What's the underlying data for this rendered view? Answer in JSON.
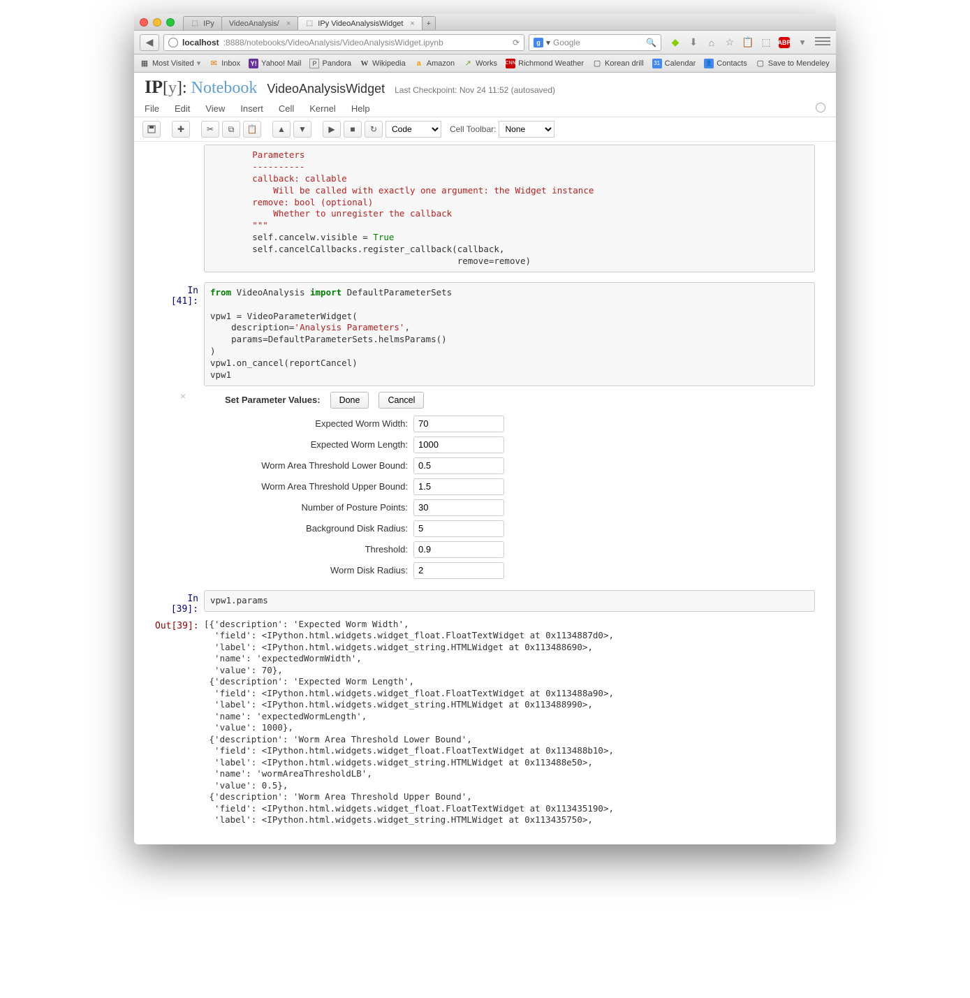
{
  "browser": {
    "tabs": [
      {
        "icon": "ipy",
        "label": "IPy",
        "active": false,
        "close": false
      },
      {
        "icon": "",
        "label": "VideoAnalysis/",
        "active": false,
        "close": true
      },
      {
        "icon": "ipy",
        "label": "IPy    VideoAnalysisWidget",
        "active": true,
        "close": true
      }
    ],
    "url_host": "localhost",
    "url_path": ":8888/notebooks/VideoAnalysis/VideoAnalysisWidget.ipynb",
    "search_placeholder": "Google",
    "bookmarks": [
      {
        "icon": "📑",
        "label": "Most Visited",
        "dd": true
      },
      {
        "icon": "📨",
        "label": "Inbox"
      },
      {
        "icon": "Y",
        "label": "Yahoo! Mail"
      },
      {
        "icon": "P",
        "label": "Pandora"
      },
      {
        "icon": "W",
        "label": "Wikipedia"
      },
      {
        "icon": "a",
        "label": "Amazon"
      },
      {
        "icon": "↗",
        "label": "Works"
      },
      {
        "icon": "▦",
        "label": "Richmond Weather"
      },
      {
        "icon": "▢",
        "label": "Korean drill"
      },
      {
        "icon": "📅",
        "label": "Calendar"
      },
      {
        "icon": "👥",
        "label": "Contacts"
      },
      {
        "icon": "▢",
        "label": "Save to Mendeley"
      }
    ]
  },
  "notebook": {
    "title": "VideoAnalysisWidget",
    "checkpoint": "Last Checkpoint: Nov 24 11:52 (autosaved)",
    "menus": [
      "File",
      "Edit",
      "View",
      "Insert",
      "Cell",
      "Kernel",
      "Help"
    ],
    "celltype": "Code",
    "celltoolbar_label": "Cell Toolbar:",
    "celltoolbar_value": "None"
  },
  "code_top": "        Parameters\n        ----------\n        callback: callable\n            Will be called with exactly one argument: the Widget instance\n        remove: bool (optional)\n            Whether to unregister the callback\n        \"\"\"",
  "code_top2a": "        self.cancelw.visible = ",
  "code_top2b": "True",
  "code_top3": "        self.cancelCallbacks.register_callback(callback,\n                                               remove=remove)",
  "cell41_prompt": "In [41]:",
  "cell41": {
    "l1a": "from",
    "l1b": " VideoAnalysis ",
    "l1c": "import",
    "l1d": " DefaultParameterSets",
    "l2": "",
    "l3": "vpw1 = VideoParameterWidget(",
    "l4a": "    description=",
    "l4b": "'Analysis Parameters'",
    "l4c": ",",
    "l5": "    params=DefaultParameterSets.helmsParams()",
    "l6": ")",
    "l7": "vpw1.on_cancel(reportCancel)",
    "l8": "vpw1"
  },
  "widget": {
    "title": "Set Parameter Values:",
    "done": "Done",
    "cancel": "Cancel",
    "fields": [
      {
        "label": "Expected Worm Width:",
        "value": "70"
      },
      {
        "label": "Expected Worm Length:",
        "value": "1000"
      },
      {
        "label": "Worm Area Threshold Lower Bound:",
        "value": "0.5"
      },
      {
        "label": "Worm Area Threshold Upper Bound:",
        "value": "1.5"
      },
      {
        "label": "Number of Posture Points:",
        "value": "30"
      },
      {
        "label": "Background Disk Radius:",
        "value": "5"
      },
      {
        "label": "Threshold:",
        "value": "0.9"
      },
      {
        "label": "Worm Disk Radius:",
        "value": "2"
      }
    ]
  },
  "cell39_in_prompt": "In [39]:",
  "cell39_code": "vpw1.params",
  "cell39_out_prompt": "Out[39]:",
  "cell39_out": "[{'description': 'Expected Worm Width',\n  'field': <IPython.html.widgets.widget_float.FloatTextWidget at 0x1134887d0>,\n  'label': <IPython.html.widgets.widget_string.HTMLWidget at 0x113488690>,\n  'name': 'expectedWormWidth',\n  'value': 70},\n {'description': 'Expected Worm Length',\n  'field': <IPython.html.widgets.widget_float.FloatTextWidget at 0x113488a90>,\n  'label': <IPython.html.widgets.widget_string.HTMLWidget at 0x113488990>,\n  'name': 'expectedWormLength',\n  'value': 1000},\n {'description': 'Worm Area Threshold Lower Bound',\n  'field': <IPython.html.widgets.widget_float.FloatTextWidget at 0x113488b10>,\n  'label': <IPython.html.widgets.widget_string.HTMLWidget at 0x113488e50>,\n  'name': 'wormAreaThresholdLB',\n  'value': 0.5},\n {'description': 'Worm Area Threshold Upper Bound',\n  'field': <IPython.html.widgets.widget_float.FloatTextWidget at 0x113435190>,\n  'label': <IPython.html.widgets.widget_string.HTMLWidget at 0x113435750>,"
}
